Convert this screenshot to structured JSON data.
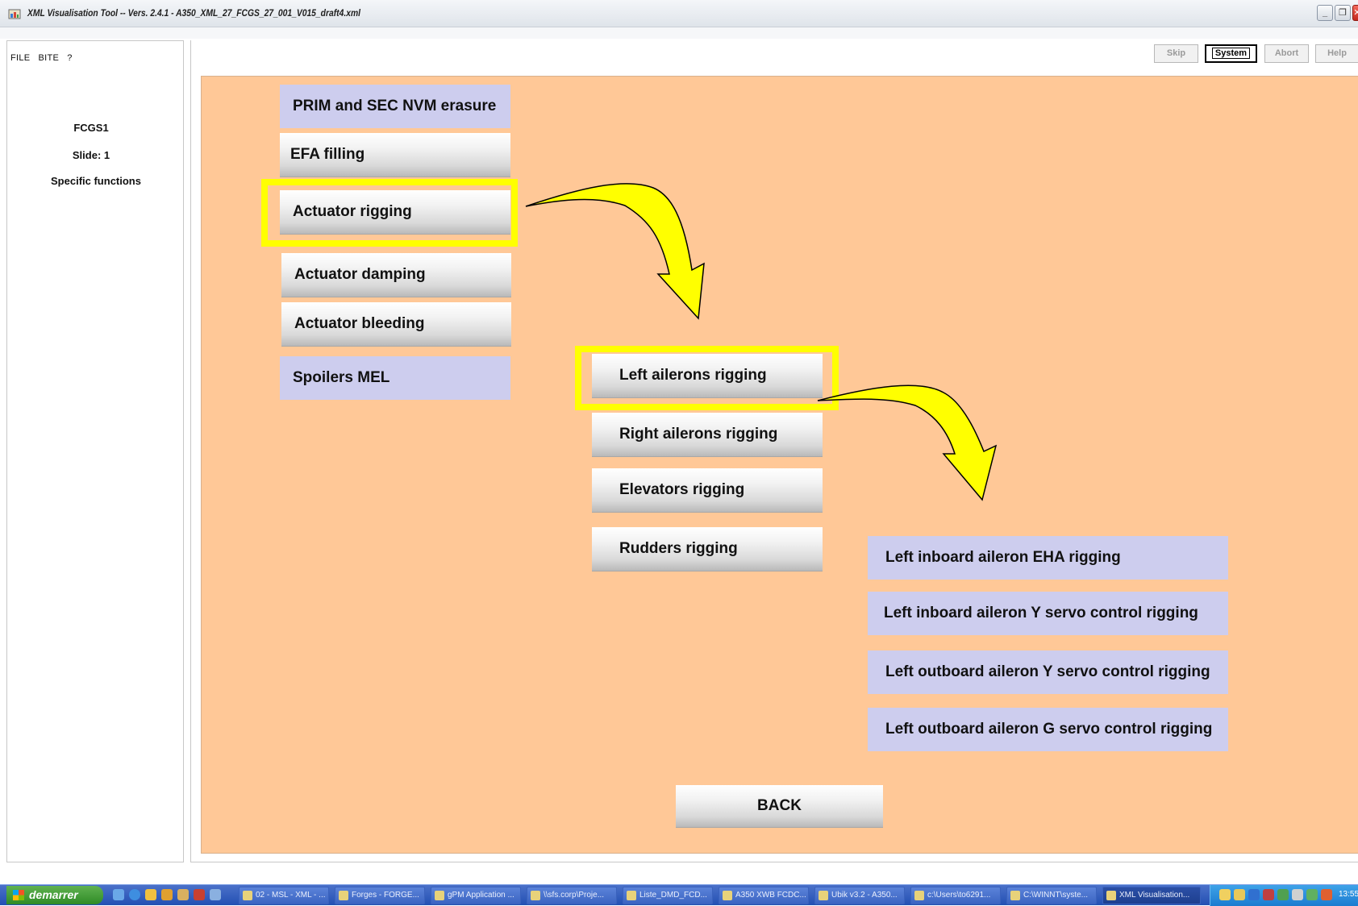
{
  "window": {
    "title": "XML Visualisation Tool -- Vers. 2.4.1 - A350_XML_27_FCGS_27_001_V015_draft4.xml",
    "controls": [
      "_",
      "❐",
      "✕"
    ]
  },
  "menubar": {
    "items": [
      "FILE",
      "BITE",
      "?"
    ]
  },
  "info": {
    "station": "FCGS1",
    "slide": "Slide: 1",
    "section": "Specific functions"
  },
  "toolbar": {
    "skip": "Skip",
    "system": "System",
    "abort": "Abort",
    "help": "Help"
  },
  "menu_level1": [
    "PRIM and SEC NVM erasure",
    "EFA filling",
    "Actuator rigging",
    "Actuator damping",
    "Actuator bleeding",
    "Spoilers MEL"
  ],
  "menu_level2": [
    "Left ailerons rigging",
    "Right ailerons rigging",
    "Elevators rigging",
    "Rudders rigging"
  ],
  "menu_level3": [
    "Left inboard aileron EHA rigging",
    "Left inboard aileron Y servo control rigging",
    "Left outboard aileron Y servo control rigging",
    "Left outboard aileron G servo control rigging"
  ],
  "back_label": "BACK",
  "colors": {
    "canvas": "#ffc897",
    "lavender_button": "#cdcdee",
    "highlight": "#ffff00"
  },
  "taskbar": {
    "start": "demarrer",
    "items": [
      "02 - MSL - XML - ...",
      "Forges - FORGE...",
      "gPM Application ...",
      "\\\\sfs.corp\\Proje...",
      "Liste_DMD_FCD...",
      "A350 XWB FCDC...",
      "Ubik v3.2 - A350...",
      "c:\\Users\\to6291...",
      "C:\\WINNT\\syste...",
      "XML Visualisation..."
    ],
    "clock": "13:55"
  }
}
